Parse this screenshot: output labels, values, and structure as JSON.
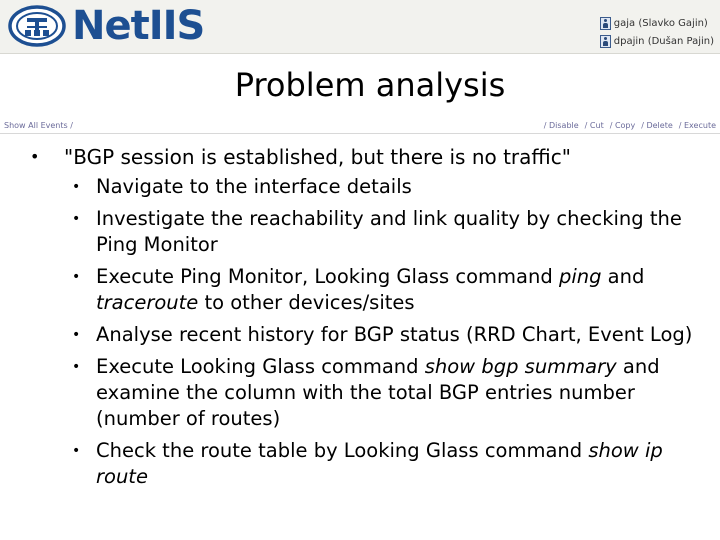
{
  "header": {
    "logo_text": "NetIIS",
    "users": [
      {
        "label": "gaja (Slavko Gajin)"
      },
      {
        "label": "dpajin (Dušan Pajin)"
      }
    ]
  },
  "title": "Problem analysis",
  "toolbar": {
    "show_all": "Show All Events /",
    "actions": [
      "/ Disable",
      "/ Cut",
      "/ Copy",
      "/ Delete",
      "/ Execute"
    ]
  },
  "content": {
    "main_item": "\"BGP session is established, but there is no traffic\"",
    "sub_items": [
      {
        "parts": [
          {
            "text": "Navigate to the interface details",
            "italic": false
          }
        ]
      },
      {
        "parts": [
          {
            "text": "Investigate the reachability and link quality by checking the Ping Monitor",
            "italic": false
          }
        ]
      },
      {
        "parts": [
          {
            "text": "Execute Ping Monitor, Looking Glass command ",
            "italic": false
          },
          {
            "text": "ping",
            "italic": true
          },
          {
            "text": " and ",
            "italic": false
          },
          {
            "text": "traceroute",
            "italic": true
          },
          {
            "text": " to other devices/sites",
            "italic": false
          }
        ]
      },
      {
        "parts": [
          {
            "text": "Analyse recent history for BGP status (RRD Chart, Event Log)",
            "italic": false
          }
        ]
      },
      {
        "parts": [
          {
            "text": "Execute Looking Glass command ",
            "italic": false
          },
          {
            "text": "show bgp summary",
            "italic": true
          },
          {
            "text": " and examine the column with the total BGP entries number (number of routes)",
            "italic": false
          }
        ]
      },
      {
        "parts": [
          {
            "text": "Check the route table by Looking Glass command ",
            "italic": false
          },
          {
            "text": "show ip route",
            "italic": true
          }
        ]
      }
    ]
  }
}
